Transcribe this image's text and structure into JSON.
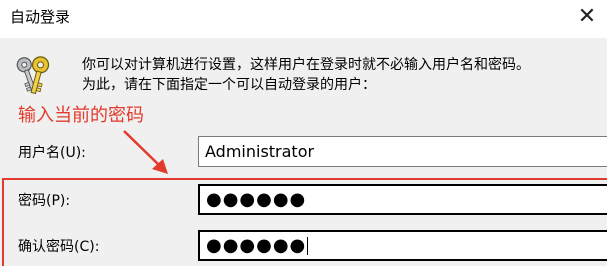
{
  "window": {
    "title": "自动登录",
    "close_symbol": "✕"
  },
  "description": {
    "line1": "你可以对计算机进行设置，这样用户在登录时就不必输入用户名和密码。",
    "line2": "为此，请在下面指定一个可以自动登录的用户："
  },
  "annotation": {
    "text": "输入当前的密码",
    "color": "#e23a2c"
  },
  "form": {
    "username": {
      "label": "用户名(U):",
      "value": "Administrator"
    },
    "password": {
      "label": "密码(P):",
      "value": "●●●●●●"
    },
    "confirm_password": {
      "label": "确认密码(C):",
      "value": "●●●●●●"
    }
  },
  "icons": {
    "dialog_icon": "keys-icon",
    "close": "close-icon"
  }
}
